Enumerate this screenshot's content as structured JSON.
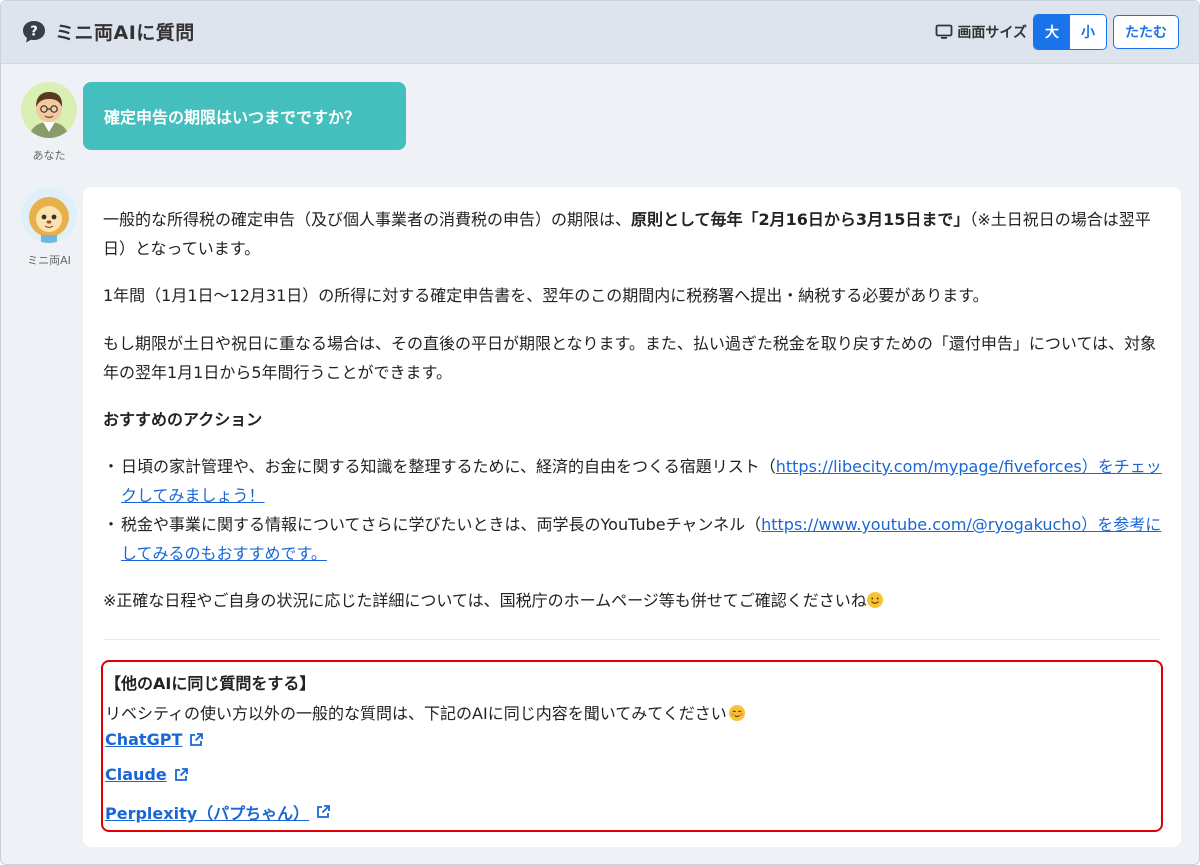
{
  "header": {
    "title": "ミニ両AIに質問",
    "icon": "question-bubble-icon",
    "size_label": "画面サイズ",
    "size_large": "大",
    "size_small": "小",
    "collapse_label": "たたむ",
    "accent": "#1a73e8"
  },
  "user": {
    "label": "あなた",
    "question": "確定申告の期限はいつまでですか？",
    "bubble_color": "#45bfbd"
  },
  "ai": {
    "label": "ミニ両AI",
    "p1_pre": "一般的な所得税の確定申告（及び個人事業者の消費税の申告）の期限は、",
    "p1_bold": "原則として毎年「2月16日から3月15日まで」",
    "p1_post": "（※土日祝日の場合は翌平日）となっています。",
    "p2": "1年間（1月1日〜12月31日）の所得に対する確定申告書を、翌年のこの期間内に税務署へ提出・納税する必要があります。",
    "p3": "もし期限が土日や祝日に重なる場合は、その直後の平日が期限となります。また、払い過ぎた税金を取り戻すための「還付申告」については、対象年の翌年1月1日から5年間行うことができます。",
    "actions_title": "おすすめのアクション",
    "bullet_mark": "・",
    "bullet1_pre": "日頃の家計管理や、お金に関する知識を整理するために、経済的自由をつくる宿題リスト（",
    "bullet1_link": "https://libecity.com/mypage/fiveforces）をチェックしてみましょう！",
    "bullet2_pre": "税金や事業に関する情報についてさらに学びたいときは、両学長のYouTubeチャンネル（",
    "bullet2_link": "https://www.youtube.com/@ryogakucho）を参考にしてみるのもおすすめです。",
    "note": "※正確な日程やご自身の状況に応じた詳細については、国税庁のホームページ等も併せてご確認くださいね"
  },
  "other_ai": {
    "title": "【他のAIに同じ質問をする】",
    "description": "リベシティの使い方以外の一般的な質問は、下記のAIに同じ内容を聞いてみてください",
    "links": [
      "ChatGPT",
      "Claude",
      "Perplexity（パプちゃん）"
    ],
    "link_icon": "external-link-icon",
    "highlight_color": "#e00000"
  }
}
